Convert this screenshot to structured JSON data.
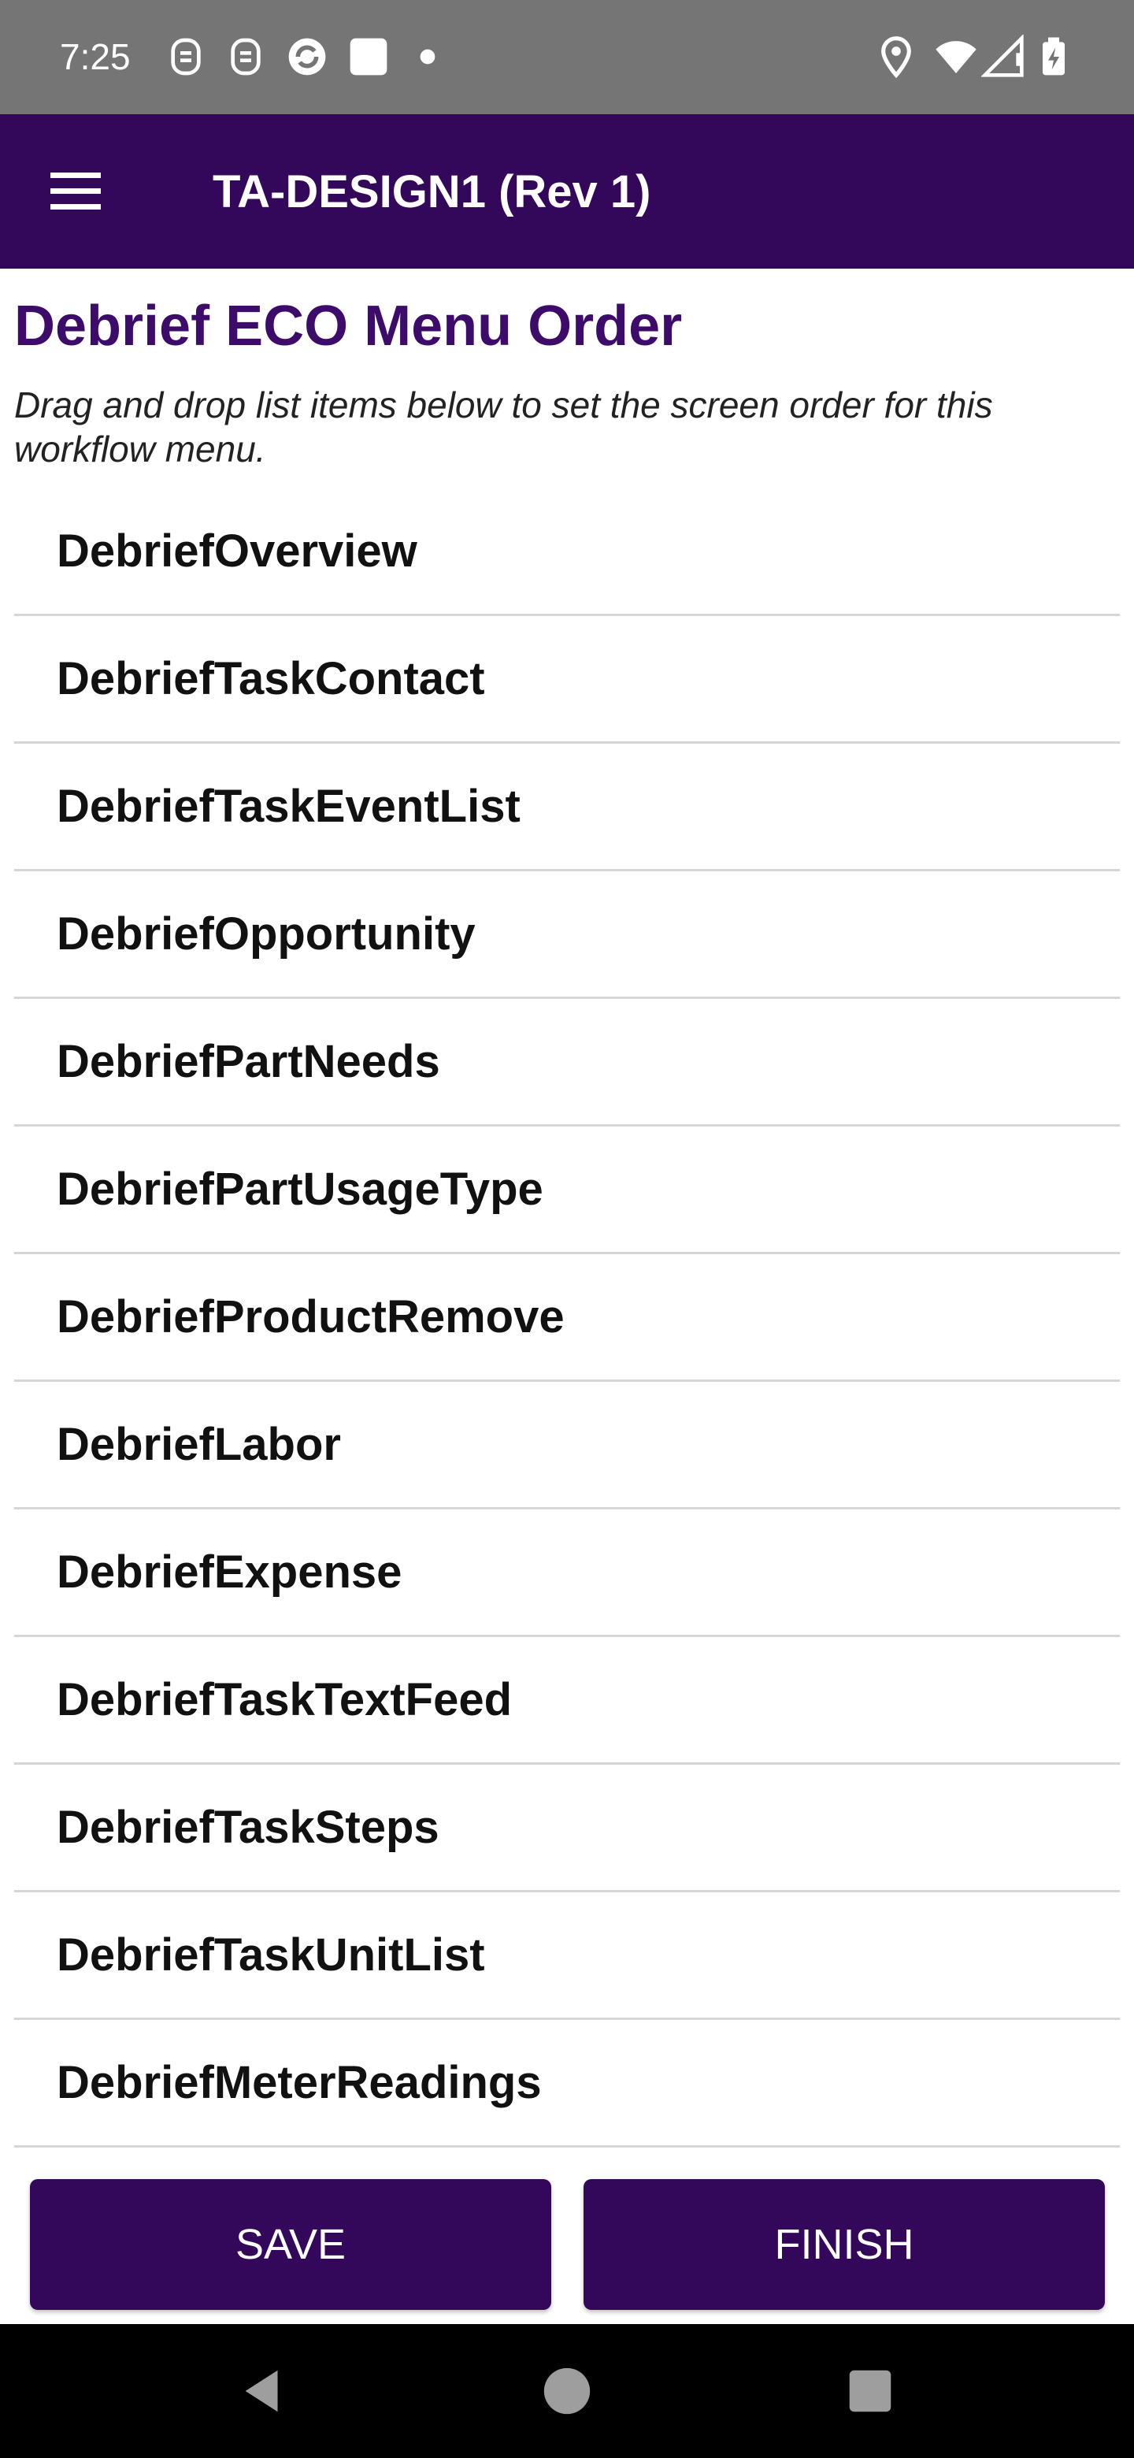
{
  "status_bar": {
    "time": "7:25",
    "left_icons": [
      "notification-icon",
      "notification-icon",
      "sync-icon",
      "square-icon",
      "dot-icon"
    ],
    "right_icons": [
      "location-icon",
      "wifi-icon",
      "signal-icon",
      "battery-charging-icon"
    ]
  },
  "app_bar": {
    "title": "TA-DESIGN1 (Rev 1)",
    "menu_icon": "hamburger-menu-icon",
    "color": "#33075a"
  },
  "page": {
    "title": "Debrief ECO Menu Order",
    "description": "Drag and drop list items below to set the screen order for this workflow menu.",
    "title_color": "#3d0c6a"
  },
  "menu_items": [
    "DebriefOverview",
    "DebriefTaskContact",
    "DebriefTaskEventList",
    "DebriefOpportunity",
    "DebriefPartNeeds",
    "DebriefPartUsageType",
    "DebriefProductRemove",
    "DebriefLabor",
    "DebriefExpense",
    "DebriefTaskTextFeed",
    "DebriefTaskSteps",
    "DebriefTaskUnitList",
    "DebriefMeterReadings"
  ],
  "buttons": {
    "save": "SAVE",
    "finish": "FINISH"
  },
  "nav_bar": {
    "icons": [
      "back-icon",
      "home-icon",
      "recents-icon"
    ]
  }
}
